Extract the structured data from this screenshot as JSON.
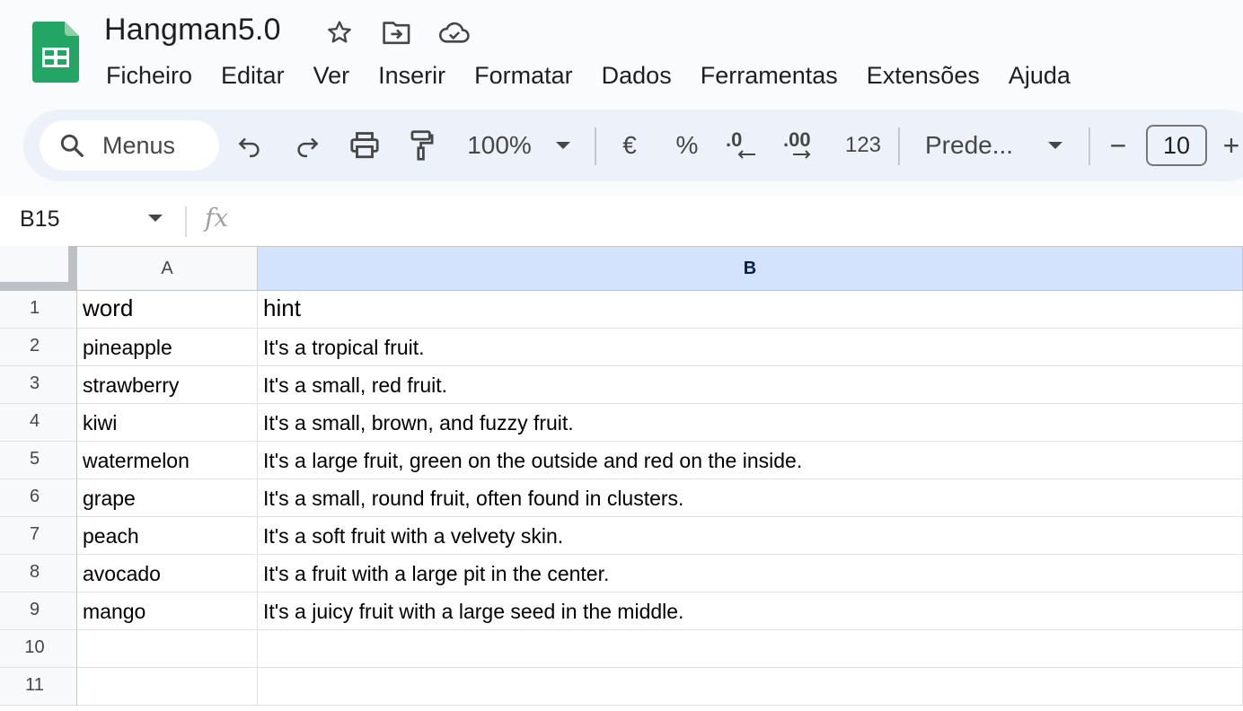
{
  "title": "Hangman5.0",
  "menu": [
    "Ficheiro",
    "Editar",
    "Ver",
    "Inserir",
    "Formatar",
    "Dados",
    "Ferramentas",
    "Extensões",
    "Ajuda"
  ],
  "toolbar": {
    "search_label": "Menus",
    "zoom": "100%",
    "currency": "€",
    "percent": "%",
    "decimal_decrease": ".0",
    "decimal_increase": ".00",
    "more_formats": "123",
    "font_name": "Prede...",
    "font_size": "10",
    "minus": "−",
    "plus": "+"
  },
  "formula_bar": {
    "cell_ref": "B15",
    "fx": "fx"
  },
  "columns": [
    "A",
    "B"
  ],
  "rows": [
    {
      "n": "1",
      "a": "word",
      "b": "hint"
    },
    {
      "n": "2",
      "a": "pineapple",
      "b": "It's a tropical fruit."
    },
    {
      "n": "3",
      "a": "strawberry",
      "b": "It's a small, red fruit."
    },
    {
      "n": "4",
      "a": "kiwi",
      "b": "It's a small, brown, and fuzzy fruit."
    },
    {
      "n": "5",
      "a": "watermelon",
      "b": "It's a large fruit, green on the outside and red on the inside."
    },
    {
      "n": "6",
      "a": "grape",
      "b": "It's a small, round fruit, often found in clusters."
    },
    {
      "n": "7",
      "a": "peach",
      "b": "It's a soft fruit with a velvety skin."
    },
    {
      "n": "8",
      "a": "avocado",
      "b": "It's a fruit with a large pit in the center."
    },
    {
      "n": "9",
      "a": "mango",
      "b": "It's a juicy fruit with a large seed in the middle."
    },
    {
      "n": "10",
      "a": "",
      "b": ""
    },
    {
      "n": "11",
      "a": "",
      "b": ""
    }
  ],
  "colors": {
    "accent": "#0b57d0",
    "selected_header": "#d3e3fd",
    "sheets_green": "#23a566"
  }
}
